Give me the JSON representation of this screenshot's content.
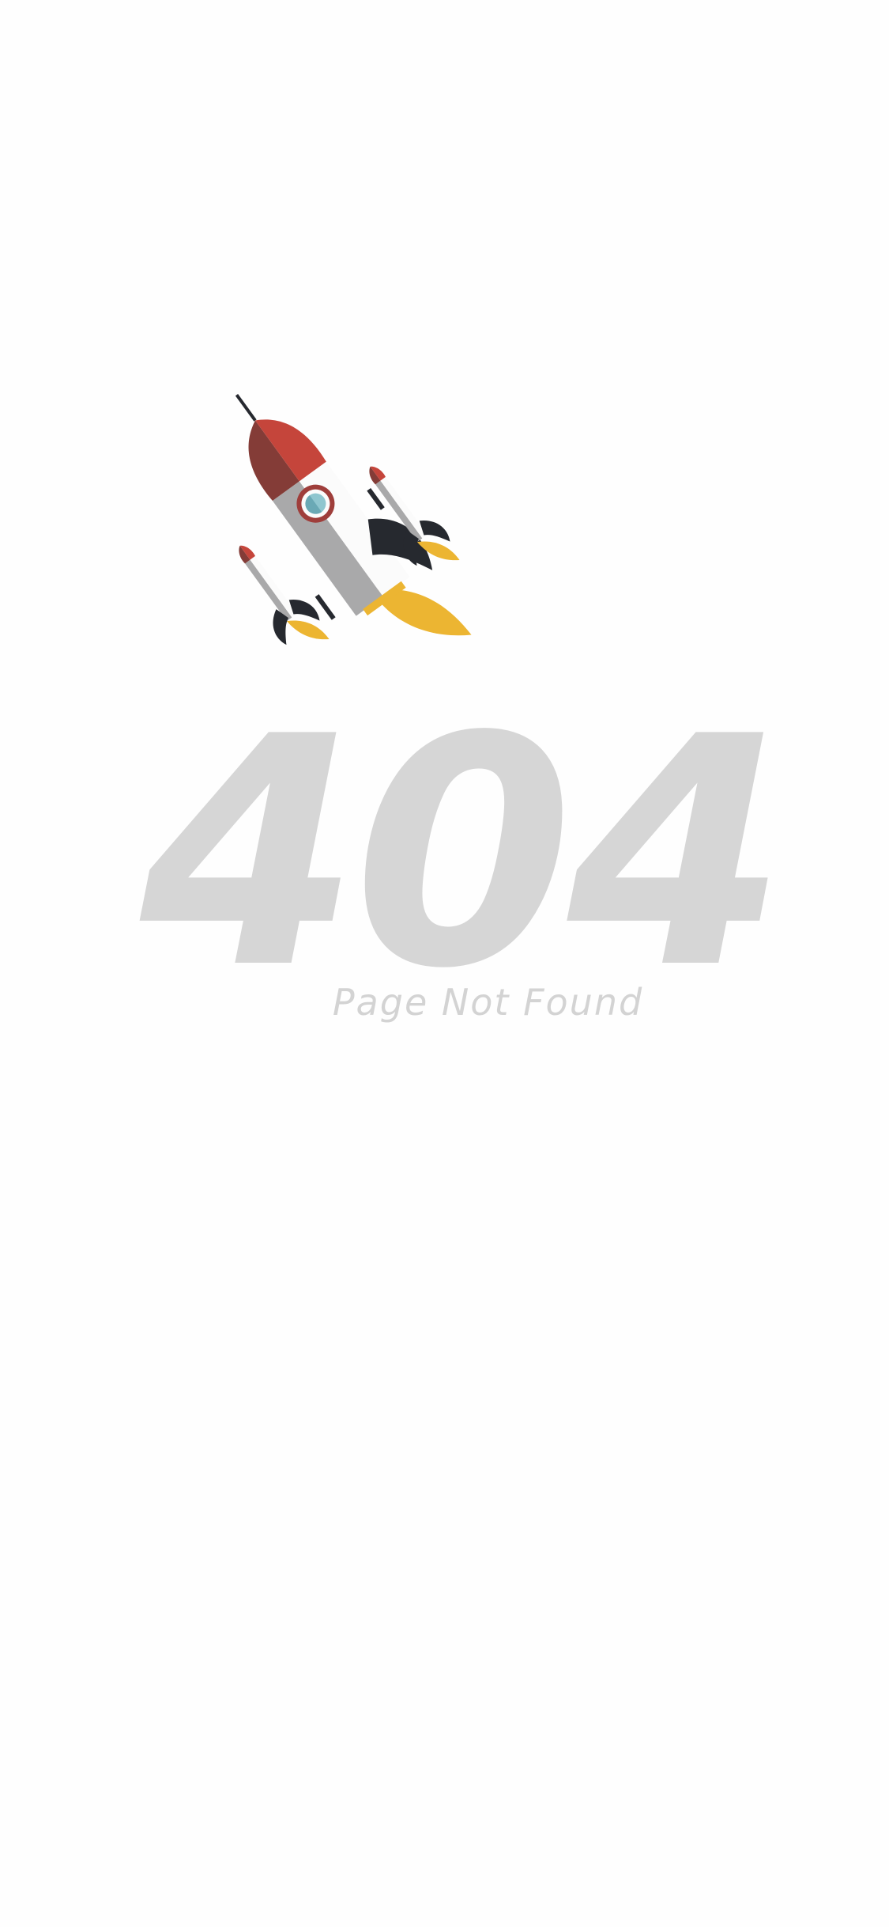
{
  "error": {
    "code": "404",
    "message": "Page Not Found"
  },
  "illustration": {
    "icon": "rocket-icon",
    "colors": {
      "nose": "#c5453b",
      "nose_shade": "#843c37",
      "body": "#fbfbfb",
      "body_shade": "#a9a9aa",
      "window_ring": "#9f3e3b",
      "window_glass": "#8fc6cf",
      "fin": "#26292f",
      "flame": "#ecb532"
    }
  },
  "theme": {
    "background": "#fefefe",
    "text_color": "#d6d6d6"
  }
}
